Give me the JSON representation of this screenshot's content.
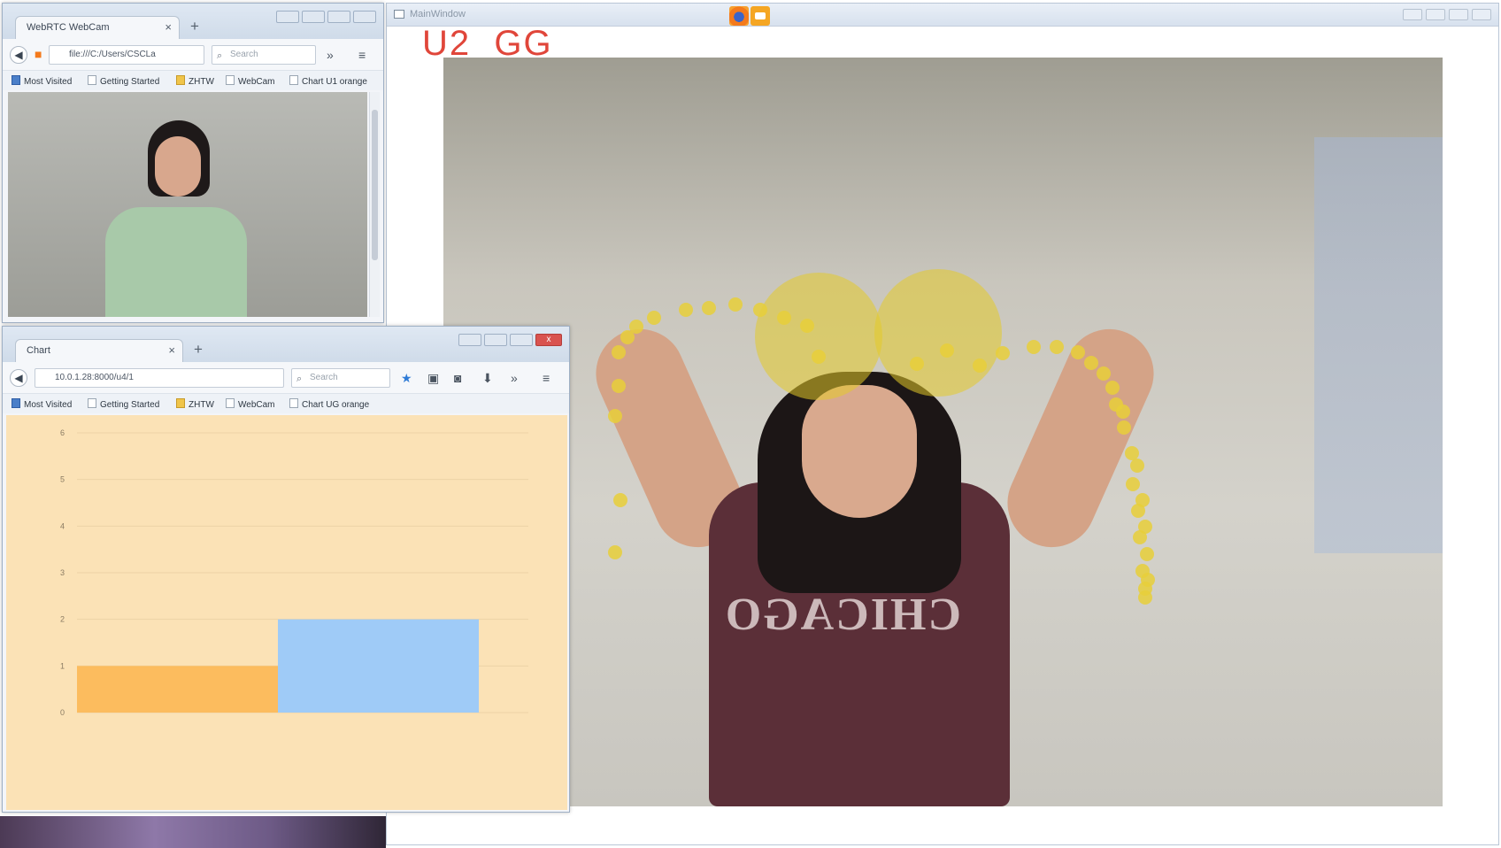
{
  "main_window": {
    "title": "MainWindow",
    "label": "U2  GG"
  },
  "webcam_browser": {
    "tab_title": "WebRTC WebCam",
    "url": "file:///C:/Users/CSCLa",
    "search_placeholder": "Search",
    "bookmarks": [
      "Most Visited",
      "Getting Started",
      "ZHTW",
      "WebCam",
      "Chart U1 orange"
    ]
  },
  "chart_browser": {
    "tab_title": "Chart",
    "url": "10.0.1.28:8000/u4/1",
    "search_placeholder": "Search",
    "bookmarks": [
      "Most Visited",
      "Getting Started",
      "ZHTW",
      "WebCam",
      "Chart UG orange"
    ]
  },
  "colors": {
    "accent_label": "#e0463a",
    "bar_orange": "#fcbc5e",
    "bar_blue": "#9fcbf7",
    "chart_background": "#fbe2b6",
    "tracking_dot": "#e8cf3a"
  },
  "icons": [
    "back-arrow-icon",
    "reload-icon",
    "search-icon",
    "bookmark-star-icon",
    "reader-icon",
    "pocket-icon",
    "download-icon",
    "overflow-icon",
    "hamburger-menu-icon",
    "firefox-icon",
    "webcam-app-icon"
  ],
  "chart_data": {
    "type": "bar",
    "categories": [
      "",
      ""
    ],
    "values": [
      1,
      2
    ],
    "colors": [
      "#fcbc5e",
      "#9fcbf7"
    ],
    "title": "",
    "xlabel": "",
    "ylabel": "",
    "ylim": [
      0,
      6
    ],
    "yticks": [
      0,
      1,
      2,
      3,
      4,
      5,
      6
    ],
    "grid": true
  }
}
